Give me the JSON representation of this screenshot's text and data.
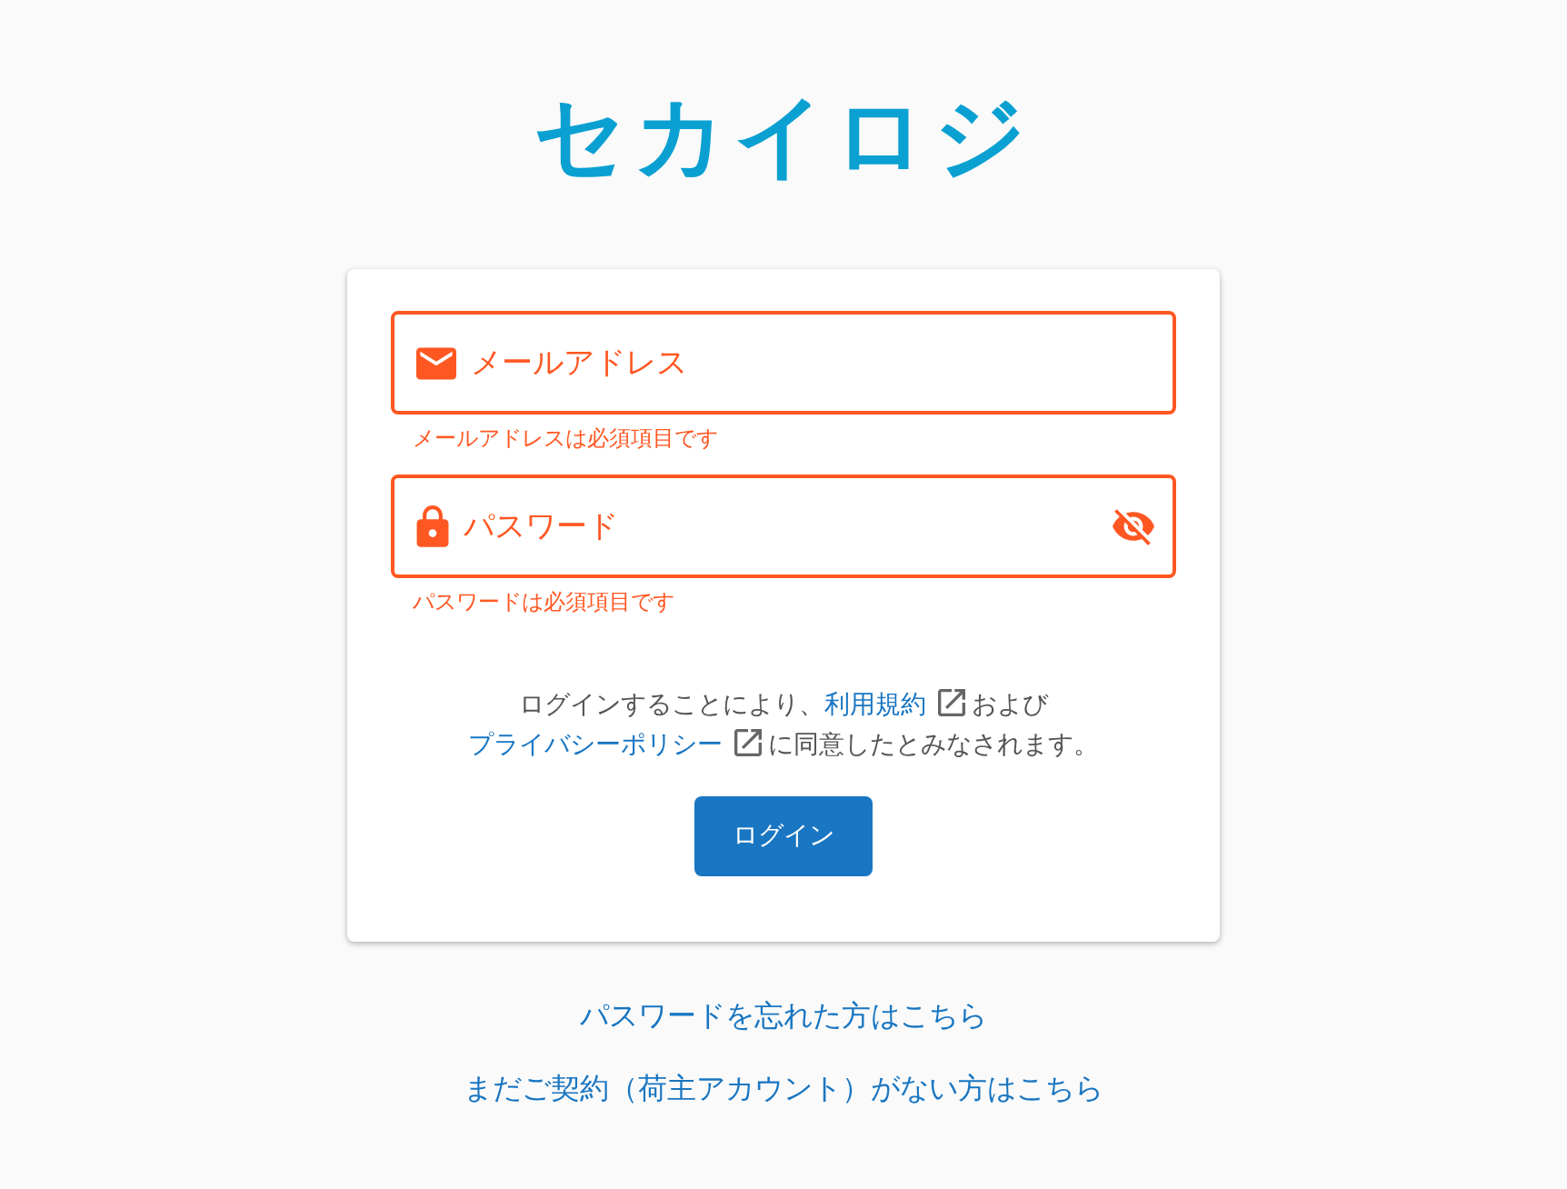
{
  "logo": {
    "text": "セカイロジ"
  },
  "fields": [
    {
      "kind": "email",
      "placeholder": "メールアドレス",
      "invalid": true,
      "error": "メールアドレスは必須項目です"
    },
    {
      "kind": "password",
      "placeholder": "パスワード",
      "invalid": true,
      "visible": false,
      "error": "パスワードは必須項目です"
    }
  ],
  "agreement": [
    {
      "kind": "text",
      "text": "ログインすることにより、"
    },
    {
      "kind": "link",
      "text": "利用規約"
    },
    {
      "kind": "text",
      "text": "および"
    },
    {
      "kind": "break"
    },
    {
      "kind": "link",
      "text": "プライバシーポリシー"
    },
    {
      "kind": "text",
      "text": "に同意したとみなされます。"
    }
  ],
  "login_button": "ログイン",
  "links": [
    "パスワードを忘れた方はこちら",
    "まだご契約（荷主アカウント）がない方はこちら"
  ]
}
